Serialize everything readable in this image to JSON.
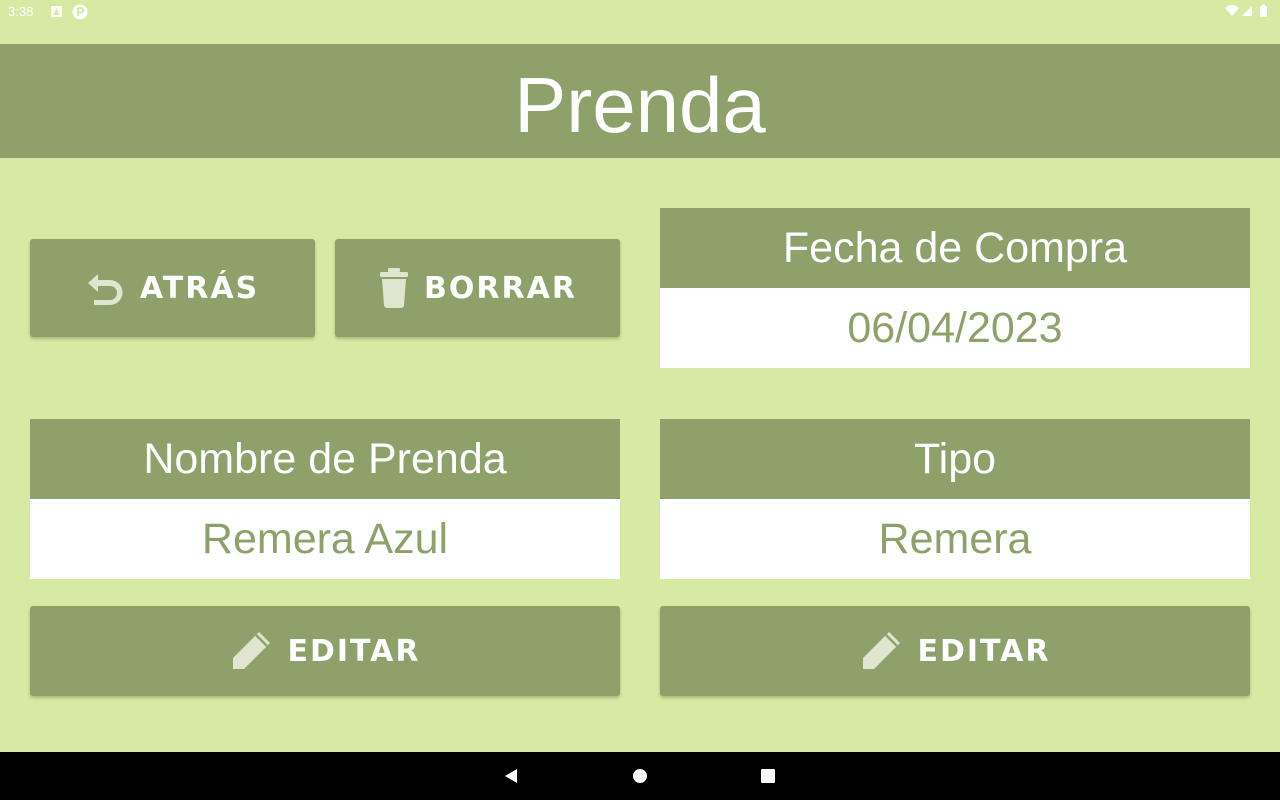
{
  "status_bar": {
    "time": "3:38",
    "icons": [
      "notification-a-icon",
      "notification-p-icon",
      "wifi-icon",
      "signal-icon",
      "battery-icon"
    ]
  },
  "header": {
    "title": "Prenda"
  },
  "actions": {
    "back_label": "ATRÁS",
    "delete_label": "BORRAR"
  },
  "fields": {
    "purchase_date": {
      "label": "Fecha de Compra",
      "value": "06/04/2023"
    },
    "name": {
      "label": "Nombre de Prenda",
      "value": "Remera Azul",
      "edit_label": "EDITAR"
    },
    "type": {
      "label": "Tipo",
      "value": "Remera",
      "edit_label": "EDITAR"
    }
  },
  "colors": {
    "background": "#d6eaa3",
    "accent": "#8fa16b",
    "text_light": "#ffffff",
    "icon_light": "#dfe5cf"
  },
  "nav_bar": {
    "icons": [
      "back-triangle-icon",
      "home-circle-icon",
      "recents-square-icon"
    ]
  }
}
